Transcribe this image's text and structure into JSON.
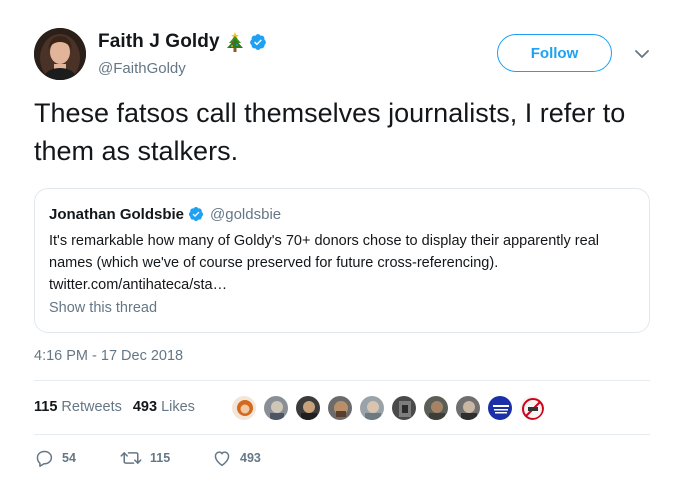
{
  "author": {
    "display_name": "Faith J Goldy",
    "emoji_icon": "christmas-tree-icon",
    "verified": true,
    "handle": "@FaithGoldy"
  },
  "follow_button": {
    "label": "Follow"
  },
  "tweet_text": "These fatsos call themselves journalists, I refer to them as stalkers.",
  "quoted_tweet": {
    "display_name": "Jonathan Goldsbie",
    "verified": true,
    "handle": "@goldsbie",
    "text": "It's remarkable how many of Goldy's 70+ donors chose to display their apparently real names (which we've of course preserved for future cross-referencing).",
    "link": "twitter.com/antihateca/sta…",
    "show_thread": "Show this thread"
  },
  "timestamp": "4:16 PM - 17 Dec 2018",
  "stats": {
    "retweets_count": "115",
    "retweets_label": "Retweets",
    "likes_count": "493",
    "likes_label": "Likes"
  },
  "liker_avatars": [
    "avatar-1",
    "avatar-2",
    "avatar-3",
    "avatar-4",
    "avatar-5",
    "avatar-6",
    "avatar-7",
    "avatar-8",
    "avatar-9",
    "avatar-10"
  ],
  "actions": {
    "reply_count": "54",
    "retweet_count": "115",
    "like_count": "493"
  },
  "colors": {
    "accent": "#1da1f2",
    "secondary_text": "#657786",
    "primary_text": "#14171a",
    "border": "#e1e8ed"
  }
}
